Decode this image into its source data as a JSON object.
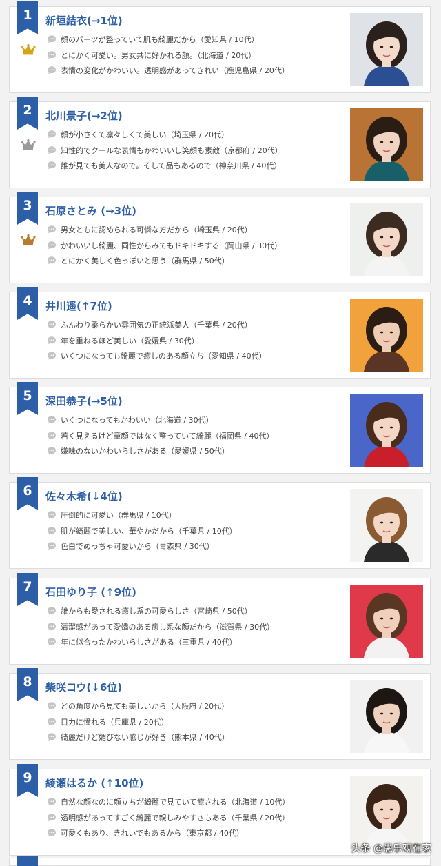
{
  "colors": {
    "accent": "#2d5fa8",
    "gold": "#d6a417",
    "silver": "#9a9a9a",
    "bronze": "#b87a2e",
    "bubble": "#c4c4c4"
  },
  "entries": [
    {
      "rank": "1",
      "name": "新垣結衣(→1位)",
      "crown": "gold",
      "photo": {
        "bg": "#dfe3e8",
        "hair": "#2a211c",
        "skin": "#f3dbcb",
        "cloth": "#2c4f93"
      },
      "comments": [
        "顔のパーツが整っていて肌も綺麗だから（愛知県 / 10代）",
        "とにかく可愛い。男女共に好かれる顔。（北海道 / 20代）",
        "表情の変化がかわいい。透明感があってきれい（鹿児島県 / 20代）"
      ]
    },
    {
      "rank": "2",
      "name": "北川景子(→2位)",
      "crown": "silver",
      "photo": {
        "bg": "#b97435",
        "hair": "#2a1d14",
        "skin": "#f0d3c1",
        "cloth": "#17606a"
      },
      "comments": [
        "顔が小さくて凛々しくて美しい（埼玉県 / 20代）",
        "知性的でクールな表情もかわいいし笑顔も素敵（京都府 / 20代）",
        "誰が見ても美人なので。そして品もあるので（神奈川県 / 40代）"
      ]
    },
    {
      "rank": "3",
      "name": "石原さとみ (→3位)",
      "crown": "bronze",
      "photo": {
        "bg": "#eef0ee",
        "hair": "#3b2b20",
        "skin": "#f2d8c8",
        "cloth": "#f4f4f4"
      },
      "comments": [
        "男女ともに認められる可憐な方だから（埼玉県 / 20代）",
        "かわいいし綺麗、同性からみてもドキドキする（岡山県 / 30代）",
        "とにかく美しく色っぽいと思う（群馬県 / 50代）"
      ]
    },
    {
      "rank": "4",
      "name": "井川遥(↑7位)",
      "crown": "",
      "photo": {
        "bg": "#f1a23c",
        "hair": "#2c1d14",
        "skin": "#efcdb5",
        "cloth": "#5a3525"
      },
      "comments": [
        "ふんわり柔らかい雰囲気の正統派美人（千葉県 / 20代）",
        "年を重ねるほど美しい（愛媛県 / 30代）",
        "いくつになっても綺麗で癒しのある顔立ち（愛知県 / 40代）"
      ]
    },
    {
      "rank": "5",
      "name": "深田恭子(→5位)",
      "crown": "",
      "photo": {
        "bg": "#4a66c9",
        "hair": "#4a2c1c",
        "skin": "#f4d6c6",
        "cloth": "#c81f2b"
      },
      "comments": [
        "いくつになってもかわいい（北海道 / 30代）",
        "若く見えるけど童顔ではなく整っていて綺麗（福岡県 / 40代）",
        "嫌味のないかわいらしさがある（愛媛県 / 50代）"
      ]
    },
    {
      "rank": "6",
      "name": "佐々木希(↓4位)",
      "crown": "",
      "photo": {
        "bg": "#f3f3f1",
        "hair": "#8a5a33",
        "skin": "#f4d8c6",
        "cloth": "#2a2a2a"
      },
      "comments": [
        "圧倒的に可愛い（群馬県 / 10代）",
        "肌が綺麗で美しい、華やかだから（千葉県 / 10代）",
        "色白でめっちゃ可愛いから（青森県 / 30代）"
      ]
    },
    {
      "rank": "7",
      "name": "石田ゆり子 (↑9位)",
      "crown": "",
      "photo": {
        "bg": "#e03a4a",
        "hair": "#5a3624",
        "skin": "#f0d0bd",
        "cloth": "#f2f2f2"
      },
      "comments": [
        "誰からも愛される癒し系の可愛らしさ（宮崎県 / 50代）",
        "清潔感があって愛嬌のある癒し系な顔だから（滋賀県 / 30代）",
        "年に似合ったかわいらしさがある（三重県 / 40代）"
      ]
    },
    {
      "rank": "8",
      "name": "柴咲コウ(↓6位)",
      "crown": "",
      "photo": {
        "bg": "#f1f1f1",
        "hair": "#1d1714",
        "skin": "#eed1bf",
        "cloth": "#f7f7f7"
      },
      "comments": [
        "どの角度から見ても美しいから（大阪府 / 20代）",
        "目力に憧れる（兵庫県 / 20代）",
        "綺麗だけど媚びない感じが好き（熊本県 / 40代）"
      ]
    },
    {
      "rank": "9",
      "name": "綾瀬はるか (↑10位)",
      "crown": "",
      "photo": {
        "bg": "#f4f2ee",
        "hair": "#3a2418",
        "skin": "#f3d6c4",
        "cloth": "#f6f6f6"
      },
      "comments": [
        "自然な顔なのに顔立ちが綺麗で見ていて癒される（北海道 / 10代）",
        "透明感があってすごく綺麗で親しみやすさもある（千葉県 / 20代）",
        "可愛くもあり、きれいでもあるから（東京都 / 40代）"
      ]
    }
  ],
  "watermark": "头条 @愚乐观在家"
}
